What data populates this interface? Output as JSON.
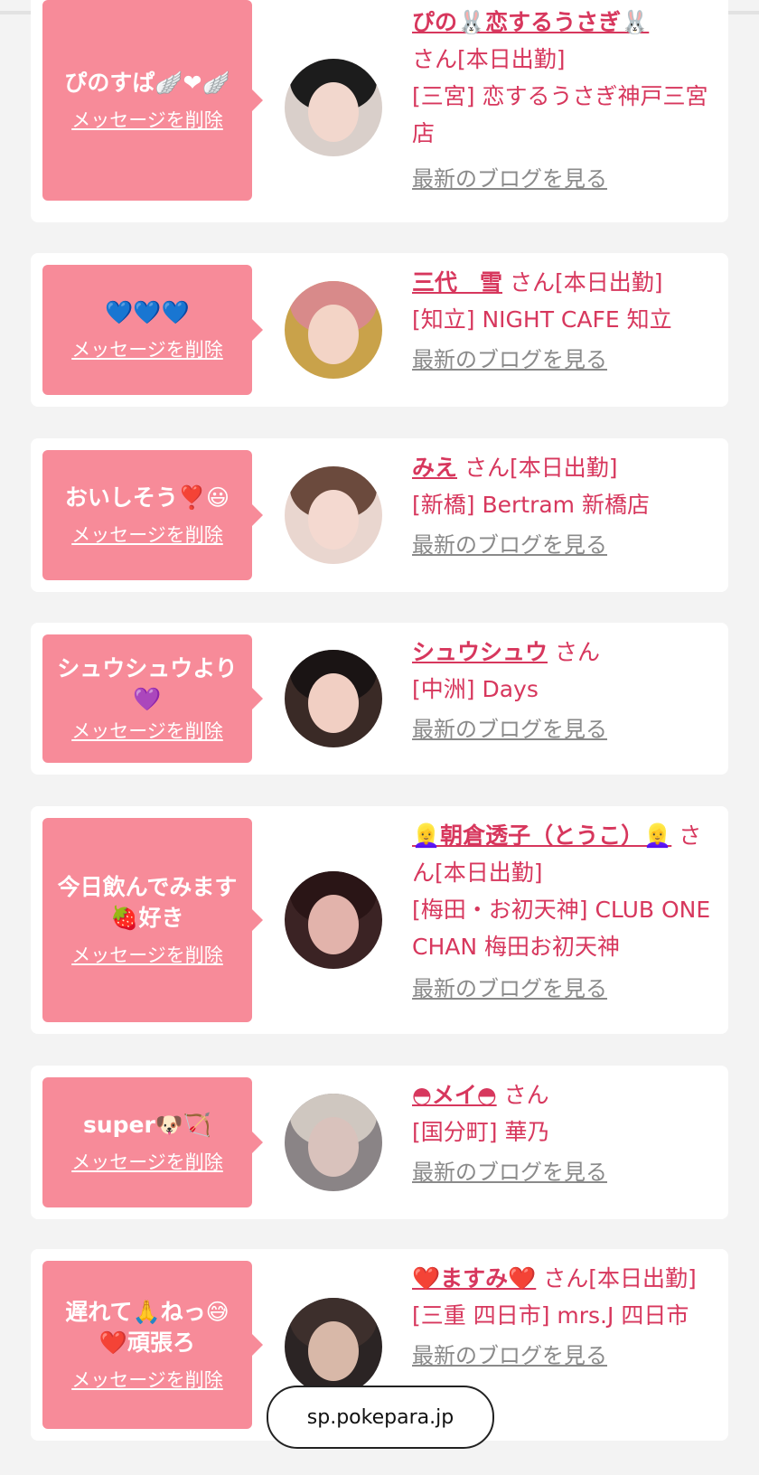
{
  "browser": {
    "url": "sp.pokepara.jp"
  },
  "common": {
    "san": "さん",
    "delete_label": "メッセージを削除",
    "blog_label": "最新のブログを見る"
  },
  "cards": [
    {
      "message": "ぴのすぱ🪽❤🪽",
      "name": "ぴの🐰恋するうさぎ🐰",
      "status": "[本日出勤]",
      "shop": "[三宮] 恋するうさぎ神戸三宮店"
    },
    {
      "message": "💙💙💙",
      "name": "三代　雪",
      "status": "[本日出勤]",
      "shop": "[知立] NIGHT CAFE 知立"
    },
    {
      "message": "おいしそう❣️😃",
      "name": "みえ",
      "status": "[本日出勤]",
      "shop": "[新橋] Bertram 新橋店"
    },
    {
      "message": "シュウシュウより💜",
      "name": "シュウシュウ",
      "status": "",
      "shop": "[中洲] Days"
    },
    {
      "message": "今日飲んでみます🍓好き",
      "name": "👱‍♀️朝倉透子（とうこ）👱‍♀️",
      "status": "[本日出勤]",
      "shop": "[梅田・お初天神] CLUB ONE CHAN 梅田お初天神"
    },
    {
      "message": "super🐶🏹",
      "name": "◓メイ◓",
      "status": "",
      "shop": "[国分町] 華乃"
    },
    {
      "message": "遅れて🙏ねっ😅❤️頑張ろ",
      "name": "❤️ますみ❤️",
      "status": "[本日出勤]",
      "shop": "[三重 四日市] mrs.J 四日市"
    }
  ],
  "colors": {
    "accent": "#d7375d",
    "bubble": "#f78b99",
    "page_bg": "#f3f3f3",
    "link_gray": "#8a8a8a"
  }
}
